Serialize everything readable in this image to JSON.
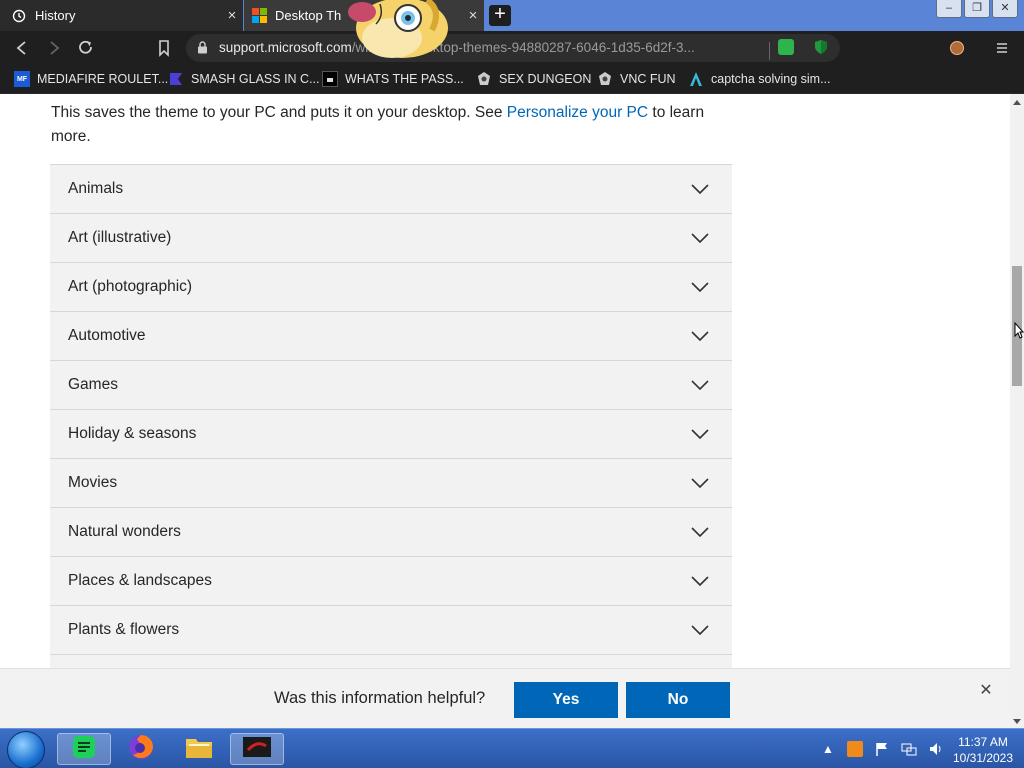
{
  "browser": {
    "tabs": [
      {
        "label": "History",
        "icon": "history-icon",
        "close": "×"
      },
      {
        "label": "Desktop Th",
        "icon": "microsoft-logo-icon",
        "close": "×"
      }
    ],
    "new_tab": "+",
    "window_controls": [
      "–",
      "❐",
      "✕"
    ],
    "url_host": "support.microsoft.com",
    "url_rest": "/windows/desktop-themes-94880287-6046-1d35-6d2f-3...",
    "bookmarks": [
      {
        "label": "MEDIAFIRE ROULET...",
        "icon": "mediafire-icon",
        "icon_text": "MF"
      },
      {
        "label": "SMASH GLASS IN C...",
        "icon": "bookmark-icon"
      },
      {
        "label": "WHATS THE PASS...",
        "icon": "bookmark-icon"
      },
      {
        "label": "SEX DUNGEON",
        "icon": "game-icon"
      },
      {
        "label": "VNC FUN",
        "icon": "game-icon"
      },
      {
        "label": "captcha solving sim...",
        "icon": "bookmark-icon"
      }
    ]
  },
  "page": {
    "intro_before": "This saves the theme to your PC and puts it on your desktop. See ",
    "intro_link": "Personalize your PC",
    "intro_after": " to learn more.",
    "categories": [
      "Animals",
      "Art (illustrative)",
      "Art (photographic)",
      "Automotive",
      "Games",
      "Holiday & seasons",
      "Movies",
      "Natural wonders",
      "Places & landscapes",
      "Plants & flowers"
    ],
    "feedback": {
      "question": "Was this information helpful?",
      "yes": "Yes",
      "no": "No",
      "close": "✕"
    }
  },
  "taskbar": {
    "time": "11:37 AM",
    "date": "10/31/2023"
  },
  "colors": {
    "link": "#0067b8",
    "button": "#0067b8",
    "accordion_bg": "#f2f2f2"
  }
}
